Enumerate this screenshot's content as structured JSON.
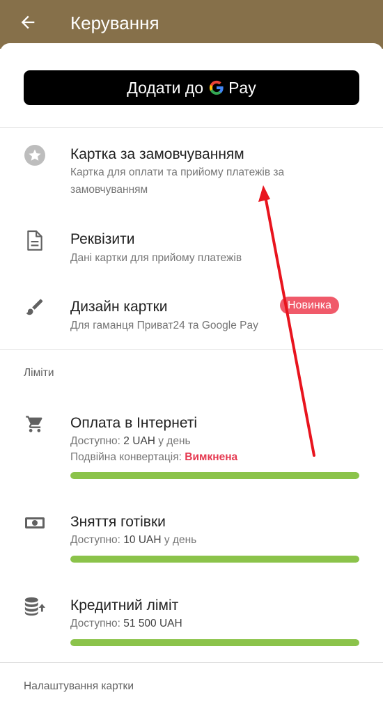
{
  "appbar": {
    "title": "Керування"
  },
  "gpay": {
    "label_prefix": "Додати до",
    "label_suffix": "Pay"
  },
  "menu": [
    {
      "title": "Картка за замовчуванням",
      "subtitle": "Картка для оплати та прийому платежів за замовчуванням",
      "icon": "star-circle-icon"
    },
    {
      "title": "Реквізити",
      "subtitle": "Дані картки для прийому платежів",
      "icon": "document-icon"
    },
    {
      "title": "Дизайн картки",
      "subtitle": "Для гаманця Приват24 та Google Pay",
      "icon": "brush-icon",
      "badge": "Новинка"
    }
  ],
  "limits": {
    "header": "Ліміти",
    "items": [
      {
        "title": "Оплата в Інтернеті",
        "avail_label": "Доступно:",
        "avail_value": "2 UAH",
        "avail_suffix": "у день",
        "extra_label": "Подвійна конвертація:",
        "extra_value": "Вимкнена",
        "progress": 1.0,
        "icon": "cart-icon"
      },
      {
        "title": "Зняття готівки",
        "avail_label": "Доступно:",
        "avail_value": "10 UAH",
        "avail_suffix": "у день",
        "progress": 1.0,
        "icon": "cash-icon"
      },
      {
        "title": "Кредитний ліміт",
        "avail_label": "Доступно:",
        "avail_value": "51 500 UAH",
        "progress": 1.0,
        "icon": "coins-up-icon"
      }
    ]
  },
  "settings": {
    "header": "Налаштування картки"
  },
  "colors": {
    "appbar": "#86704a",
    "progress": "#8bc34a",
    "badge": "#f05a6a",
    "alert_text": "#e53950",
    "annotation_arrow": "#e8141e"
  }
}
